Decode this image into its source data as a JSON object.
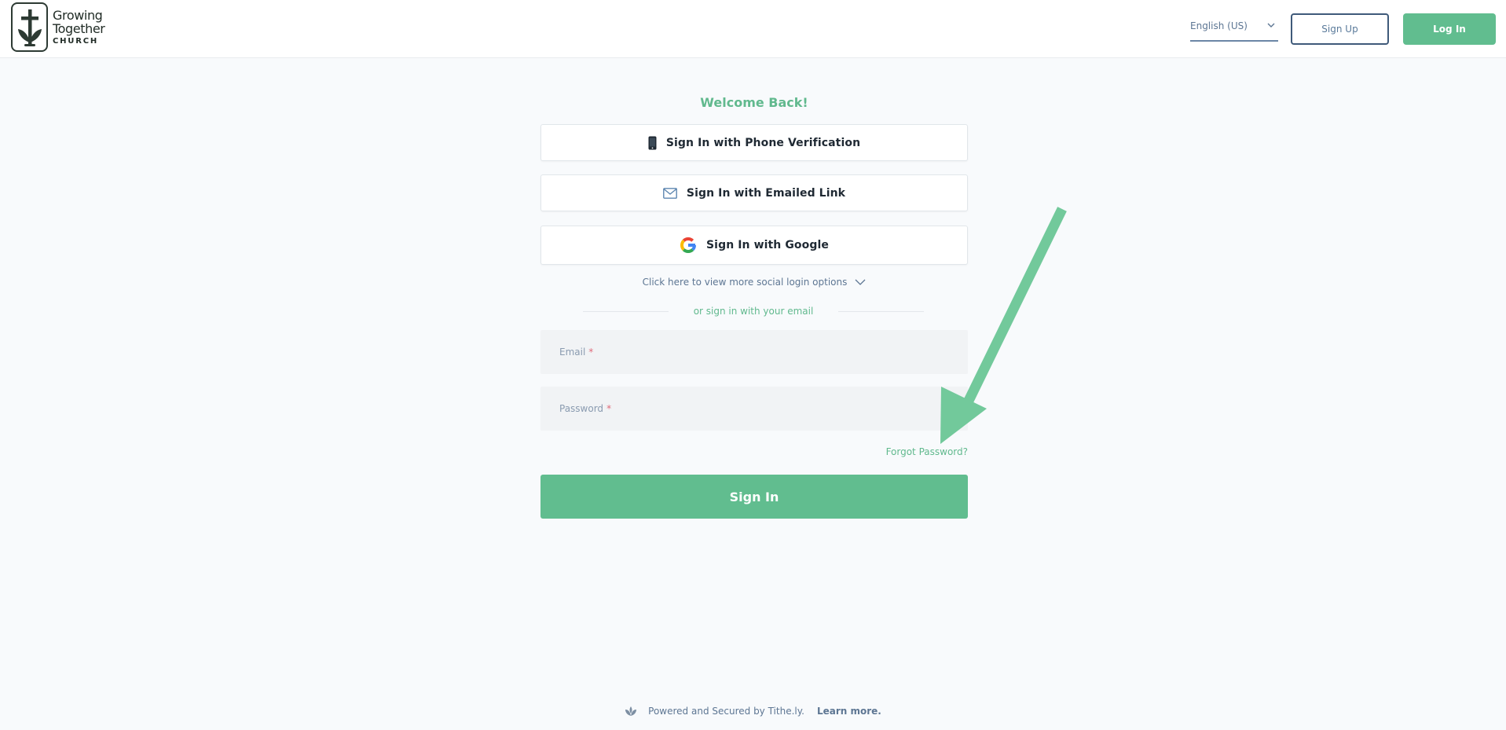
{
  "header": {
    "logo": {
      "line1": "Growing",
      "line2": "Together",
      "line3": "CHURCH",
      "icon": "cross-sprout-icon"
    },
    "language": {
      "selected": "English (US)"
    },
    "signup_label": "Sign Up",
    "login_label": "Log In"
  },
  "login": {
    "welcome": "Welcome Back!",
    "phone_label": "Sign In with Phone Verification",
    "email_link_label": "Sign In with Emailed Link",
    "google_label": "Sign In with Google",
    "more_options": "Click here to view more social login options",
    "divider_text": "or sign in with your email",
    "email_placeholder": "Email",
    "password_placeholder": "Password",
    "required_marker": "*",
    "forgot": "Forgot Password?",
    "signin_label": "Sign In"
  },
  "annotation": {
    "arrow_color": "#72c99b"
  },
  "footer": {
    "powered": "Powered and Secured by Tithe.ly.",
    "learn_more": "Learn more."
  },
  "colors": {
    "accent": "#61bd8f",
    "header_bg": "#ffffff",
    "page_bg": "#f8fafc",
    "link": "#5d7693"
  }
}
